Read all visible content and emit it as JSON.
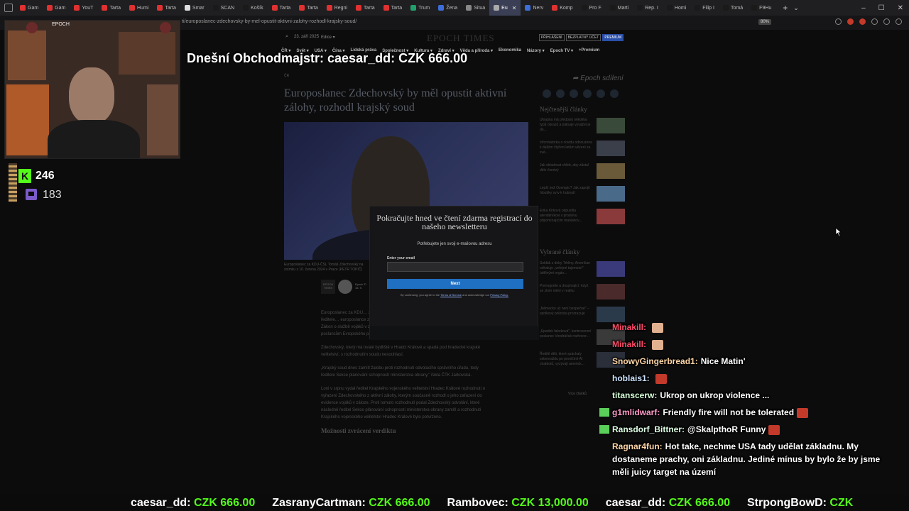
{
  "browser": {
    "tabs": [
      {
        "label": "Gam",
        "color": "#e03131"
      },
      {
        "label": "Gam",
        "color": "#e03131"
      },
      {
        "label": "YouT",
        "color": "#e03131"
      },
      {
        "label": "Tarta",
        "color": "#e03131"
      },
      {
        "label": "Humi",
        "color": "#e03131"
      },
      {
        "label": "Tarta",
        "color": "#e03131"
      },
      {
        "label": "Smar",
        "color": "#dddddd"
      },
      {
        "label": "SCAN",
        "color": "#1a1a1a"
      },
      {
        "label": "Košík",
        "color": "#1a1a1a"
      },
      {
        "label": "Tarta",
        "color": "#e03131"
      },
      {
        "label": "Tarta",
        "color": "#e03131"
      },
      {
        "label": "Regni",
        "color": "#e03131"
      },
      {
        "label": "Tarta",
        "color": "#e03131"
      },
      {
        "label": "Tarta",
        "color": "#e03131"
      },
      {
        "label": "Trum",
        "color": "#22a06b"
      },
      {
        "label": "Žena",
        "color": "#3d6dd8"
      },
      {
        "label": "Situa",
        "color": "#888888"
      },
      {
        "label": "Eu",
        "color": "#aaaaaa",
        "active": true
      },
      {
        "label": "Nerv",
        "color": "#3d6dd8"
      },
      {
        "label": "Komp",
        "color": "#e03131"
      },
      {
        "label": "Pro F",
        "color": "#1a1a1a"
      },
      {
        "label": "Marti",
        "color": "#1a1a1a"
      },
      {
        "label": "Rep. I",
        "color": "#1a1a1a"
      },
      {
        "label": "Homi",
        "color": "#1a1a1a"
      },
      {
        "label": "Filip I",
        "color": "#1a1a1a"
      },
      {
        "label": "Tomá",
        "color": "#1a1a1a"
      },
      {
        "label": "F9Hu",
        "color": "#1a1a1a"
      }
    ],
    "url": "ti/europoslanec-zdechovsky-by-mel-opustit-aktivni-zalohy-rozhodl-krajsky-soud/",
    "zoom": "80%"
  },
  "site": {
    "date": "23. září 2025",
    "edition": "Edice ▾",
    "logo": "EPOCH TIMES",
    "login": "PŘIHLÁŠENÍ",
    "free_account": "BEZPLATNÝ ÚČET",
    "premium": "PREMIUM",
    "nav": [
      "ČR ▾",
      "Svět ▾",
      "USA ▾",
      "Čína ▾",
      "Lidská práva",
      "Společnost ▾",
      "Kultura ▾",
      "Zdraví ▾",
      "Věda a příroda ▾",
      "Ekonomika",
      "Názory ▾",
      "Epoch TV ▾",
      "+Premium"
    ]
  },
  "article": {
    "breadcrumb": "ČR",
    "title": "Europoslanec Zdechovský by měl opustit aktivní zálohy, rozhodl krajský soud",
    "caption": "Europoslanec za KDU-ČSL Tomáš Zdechovský na snímku z 10. června 2024 v Praze (PETR TOPIČ)",
    "author_logo": "EPOCH TIMES",
    "author": "Epoch Ti",
    "author_date": "16. 9.",
    "paragraphs": [
      "Europoslanec za KDU… zálohy české armády… Krajský soud v Hradci… rozhodnutí ředitele… europoslance z aktivní zálohy. ČTK to řekla mluvčí soudu Kateřina Jarkovská. Zákon o službě vojáků v záloze a zákon o branné povinnosti a jejím zajišťování poslancům Evropského parlamentu takovou službu nedovolují.",
      "Zdechovský, který má trvalé bydliště v Hradci Králové a spadá pod hradecké krajské velitelství, s rozhodnutím soudu nesouhlasí.",
      "„Krajský soud dnes zamítl žalobu proti rozhodnutí odvolacího správního úřadu, tedy ředitele Sekce plánování schopností ministerstva obrany,\" řekla ČTK Jarkovská.",
      "Loni v srpnu vydal ředitel Krajského vojenského velitelství Hradec Králové rozhodnutí o vyřazení Zdechovského z aktivní zálohy, kterým současně rozhodl o jeho zařazení do evidence vojáků v záloze. Proti tomuto rozhodnutí podal Zdechovský odvolání, které následně ředitel Sekce plánování schopností ministerstva obrany zamítl a rozhodnutí Krajského vojenského velitelství Hradec Králové bylo potvrzeno."
    ],
    "section_heading": "Možnosti zvrácení verdiktu"
  },
  "sidebar": {
    "share": "➦ Epoch sdílení",
    "latest_heading": "Nejčtenější články",
    "latest": [
      "Ukrajina má předpisk několika typů obrazů a plánuje vyvážet je do...",
      "Informátorka o covidu odsouzena k dalším čtyřem letům vězení za své...",
      "Jak skladovat chléb, aby zůstal déle čerstvý",
      "Lepší než Ozempic? Jak zapojit hloubky svrv k hubnutí",
      "Erika Kirková odpustila atentátníkovi v proslovu připomínajícím manželov..."
    ],
    "featured_heading": "Vybrané články",
    "featured": [
      "Soldák z doby Trhliny. Američan odhaluje „veřejné tajemství\" údělnými orgán...",
      "Pornografie a dospívající: když se zlom mění v realitu",
      "„Německo už není bezpečné\" – spolkový policista prozrazuje",
      "„Úpadek fakeková\", kontroverzní poslanec Vondráček rozhovor...",
      "Ředitě děti, které spáchaly sebevraždu po proničině AI chatbotů, vyzývají americk..."
    ],
    "more": "Více článků"
  },
  "modal": {
    "title": "Pokračujte hned ve čtení zdarma registrací do našeho newsletteru",
    "subtitle": "Potřebujete jen svoji e-mailovou adresu",
    "email_label": "Enter your email",
    "email_value": "",
    "next": "Next",
    "terms_pre": "By continuing, you agree to the",
    "terms_link": "Terms of Service",
    "terms_mid": "and acknowledge our",
    "privacy_link": "Privacy Policy."
  },
  "stream": {
    "top_donor": "Dnešní Obchodmajstr: caesar_dd: CZK 666.00",
    "cam_label": "EPOCH",
    "kick_logo": "K",
    "kick_viewers": "246",
    "twitch_viewers": "183",
    "chat": [
      {
        "user": "Minakill:",
        "text": "",
        "emote": "face",
        "user_color": "c-red"
      },
      {
        "user": "Minakill:",
        "text": "",
        "emote": "face",
        "user_color": "c-red"
      },
      {
        "user": "SnowyGingerbread1:",
        "text": "Nice Matin'",
        "emote": "",
        "user_color": "c-peach"
      },
      {
        "user": "hoblais1:",
        "text": "",
        "emote": "red",
        "user_color": "c-lblue"
      },
      {
        "user": "titanscerw:",
        "text": "Ukrop on ukrop violence ...",
        "emote": "",
        "user_color": "c-lgreen"
      },
      {
        "user": "g1mlidwarf:",
        "text": "Friendly fire will not be tolerated",
        "emote": "red",
        "user_color": "c-pink",
        "badge": "#5ad05a"
      },
      {
        "user": "Ransdorf_Bittner:",
        "text": "@SkalpthoR Funny",
        "emote": "red",
        "user_color": "c-mint",
        "badge": "#5ad05a"
      },
      {
        "user": "Ragnar4fun:",
        "text": "Hot take, nechme USA tady udělat základnu. My dostaneme prachy, oni základnu. Jediné mínus by bylo že by jsme měli juicy target na území",
        "emote": "",
        "user_color": "c-peach"
      }
    ],
    "ticker": [
      {
        "name": "caesar_dd:",
        "amount": "CZK 666.00"
      },
      {
        "name": "ZasranyCartman:",
        "amount": "CZK 666.00"
      },
      {
        "name": "Rambovec:",
        "amount": "CZK 13,000.00"
      },
      {
        "name": "caesar_dd:",
        "amount": "CZK 666.00"
      },
      {
        "name": "StrpongBowD:",
        "amount": "CZK"
      }
    ]
  }
}
